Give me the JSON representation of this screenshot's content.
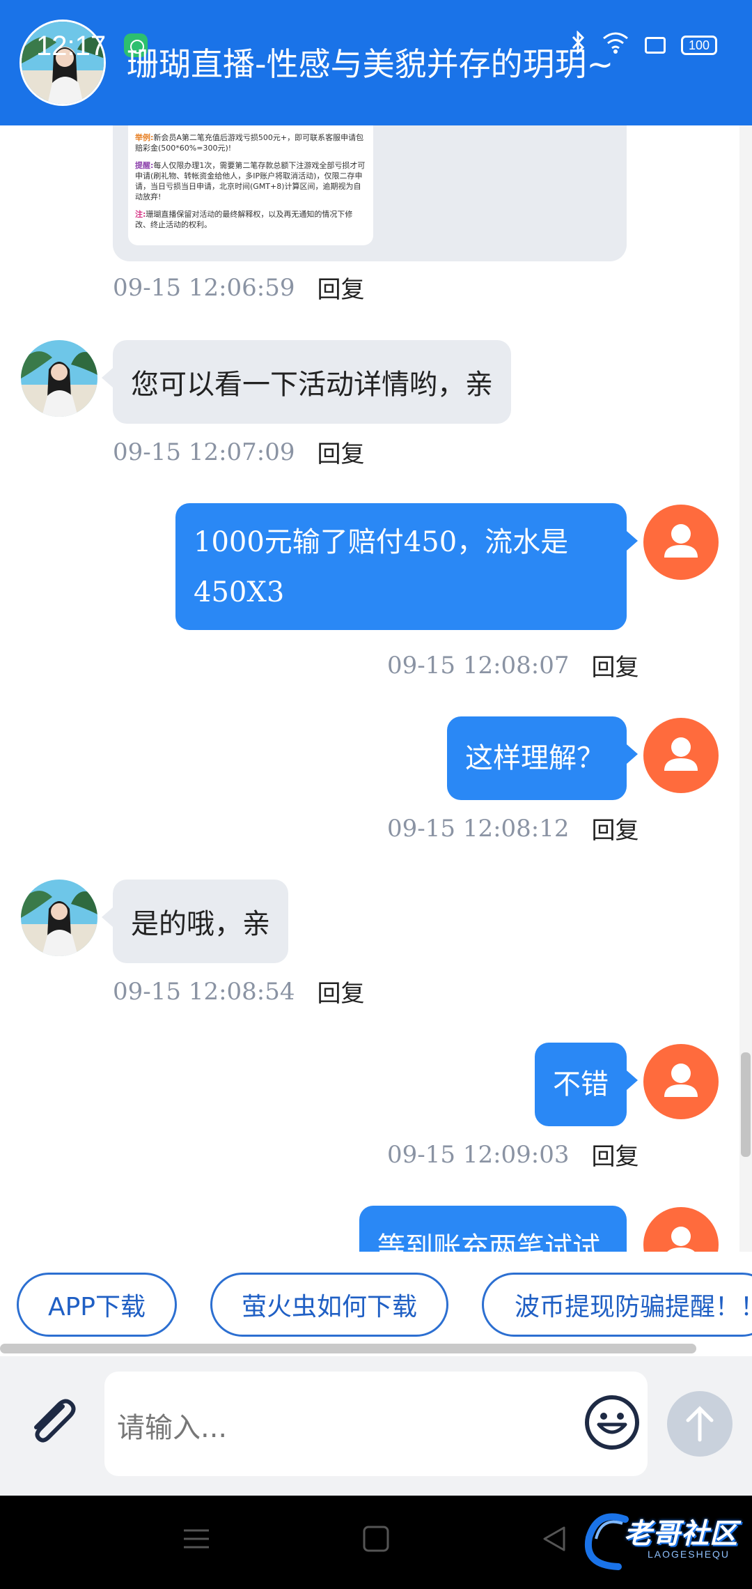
{
  "status_bar": {
    "time": "12:17",
    "battery": "100"
  },
  "header": {
    "title": "珊瑚直播-性感与美貌并存的玥玥~"
  },
  "image_message": {
    "lines": [
      {
        "tag": "举例:",
        "text": "新会员A第二笔充值后游戏亏损500元+，即可联系客服申请包赔彩金(500*60%=300元)!"
      },
      {
        "tag": "提醒:",
        "text": "每人仅限办理1次，需要第二笔存款总额下注游戏全部亏损才可申请(刷礼物、转帐资金给他人，多IP账户将取消活动)，仅限二存申请，当日亏损当日申请，北京时间(GMT+8)计算区间，逾期视为自动放弃!"
      },
      {
        "tag": "注:",
        "text": "珊瑚直播保留对活动的最终解释权，以及再无通知的情况下修改、终止活动的权利。"
      }
    ],
    "time": "09-15 12:06:59",
    "reply": "回复"
  },
  "messages": [
    {
      "side": "in",
      "text": "您可以看一下活动详情哟，亲",
      "time": "09-15 12:07:09",
      "reply": "回复"
    },
    {
      "side": "out",
      "text": "1000元输了赔付450，流水是450X3",
      "line1": "1000元输了赔付450，流水是",
      "line2": "450X3",
      "time": "09-15 12:08:07",
      "reply": "回复"
    },
    {
      "side": "out",
      "text": "这样理解？",
      "time": "09-15 12:08:12",
      "reply": "回复"
    },
    {
      "side": "in",
      "text": "是的哦，亲",
      "time": "09-15 12:08:54",
      "reply": "回复"
    },
    {
      "side": "out",
      "text": "不错",
      "time": "09-15 12:09:03",
      "reply": "回复"
    },
    {
      "side": "out",
      "text": "等到账充两笔试试",
      "partial": true
    }
  ],
  "quick_replies": [
    "APP下载",
    "萤火虫如何下载",
    "波币提现防骗提醒！！"
  ],
  "input": {
    "placeholder": "请输入..."
  },
  "watermark": {
    "text": "老哥社区",
    "sub": "LAOGESHEQU"
  },
  "colors": {
    "header": "#1a73e8",
    "outgoing_bubble": "#2a88f5",
    "incoming_bubble": "#e8ebf0",
    "user_avatar": "#ff6b3d"
  },
  "icons": [
    "attach-icon",
    "emoji-icon",
    "send-arrow-icon",
    "user-avatar-icon",
    "menu-icon",
    "home-icon",
    "back-icon"
  ]
}
